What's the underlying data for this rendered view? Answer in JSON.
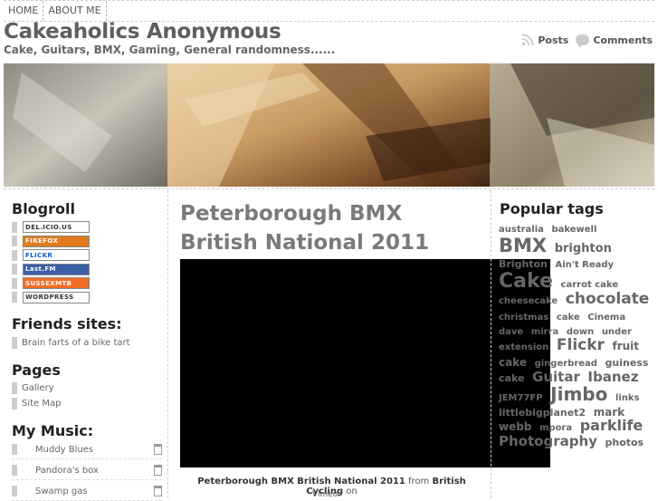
{
  "nav": {
    "home": "HOME",
    "about": "ABOUT ME"
  },
  "site": {
    "title": "Cakeaholics Anonymous",
    "tagline": "Cake, Guitars, BMX, Gaming, General randomness......"
  },
  "feeds": {
    "posts": "Posts",
    "comments": "Comments"
  },
  "left": {
    "blogroll_title": "Blogroll",
    "badges": [
      "DEL.ICIO.US",
      "FIREFOX",
      "FLICKR",
      "Last.FM",
      "SUSSEXMTB",
      "WORDPRESS"
    ],
    "friends_title": "Friends sites:",
    "friends": [
      "Brain farts of a bike tart"
    ],
    "pages_title": "Pages",
    "pages": [
      "Gallery",
      "Site Map"
    ],
    "music_title": "My Music:",
    "music": [
      "Muddy Blues",
      "Pandora's box",
      "Swamp gas"
    ]
  },
  "post": {
    "title": "Peterborough BMX British National 2011",
    "caption_link": "Peterborough BMX British National 2011",
    "caption_from": "from",
    "caption_user": "British Cycling",
    "caption_on": "on",
    "caption_tail": "Vimeo."
  },
  "right": {
    "tags_title": "Popular tags",
    "tags": [
      {
        "t": "australia",
        "s": 10
      },
      {
        "t": "bakewell",
        "s": 10
      },
      {
        "t": "BMX",
        "s": 21
      },
      {
        "t": "brighton",
        "s": 13
      },
      {
        "t": "Brighton",
        "s": 11
      },
      {
        "t": "Ain't Ready",
        "s": 10
      },
      {
        "t": "Cake",
        "s": 22
      },
      {
        "t": "carrot cake",
        "s": 10
      },
      {
        "t": "cheesecake",
        "s": 10
      },
      {
        "t": "chocolate",
        "s": 17
      },
      {
        "t": "christmas",
        "s": 10
      },
      {
        "t": "cake",
        "s": 10
      },
      {
        "t": "Cinema",
        "s": 10
      },
      {
        "t": "dave",
        "s": 10
      },
      {
        "t": "mirra",
        "s": 10
      },
      {
        "t": "down",
        "s": 10
      },
      {
        "t": "under",
        "s": 10
      },
      {
        "t": "extension",
        "s": 10
      },
      {
        "t": "Flickr",
        "s": 17
      },
      {
        "t": "fruit cake",
        "s": 12
      },
      {
        "t": "gingerbread",
        "s": 10
      },
      {
        "t": "guiness cake",
        "s": 11
      },
      {
        "t": "Guitar",
        "s": 15
      },
      {
        "t": "Ibanez",
        "s": 15
      },
      {
        "t": "JEM77FP",
        "s": 10
      },
      {
        "t": "Jimbo",
        "s": 20
      },
      {
        "t": "links",
        "s": 10
      },
      {
        "t": "littlebigplanet2",
        "s": 11
      },
      {
        "t": "mark webb",
        "s": 12
      },
      {
        "t": "mpora",
        "s": 10
      },
      {
        "t": "parklife",
        "s": 16
      },
      {
        "t": "Photography",
        "s": 15
      },
      {
        "t": "photos",
        "s": 11
      }
    ]
  }
}
